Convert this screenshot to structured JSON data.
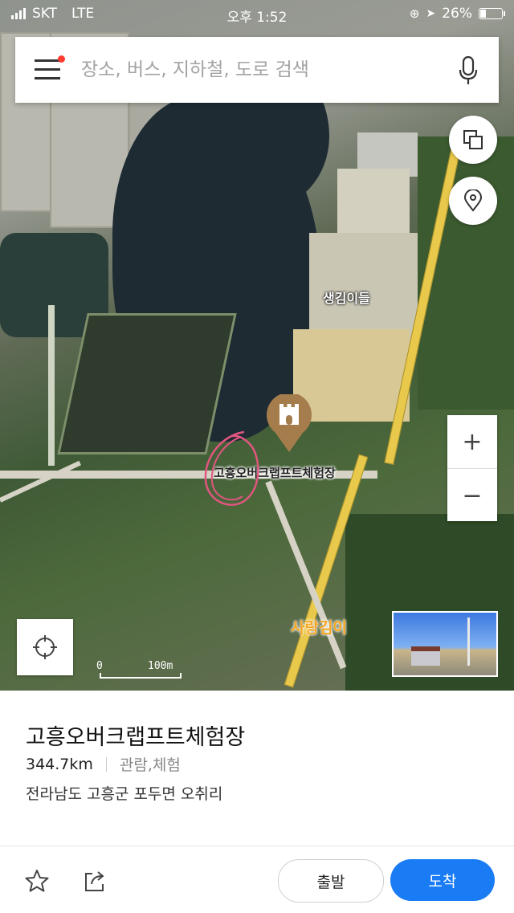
{
  "status_bar": {
    "carrier": "SKT",
    "network": "LTE",
    "time": "오후 1:52",
    "battery": "26%"
  },
  "search": {
    "placeholder": "장소, 버스, 지하철, 도로 검색"
  },
  "map": {
    "labels": {
      "area_name": "생김이들",
      "poi_name": "고흥오버크랩프트체험장",
      "nearby_poi": "사랑김이"
    },
    "scale": {
      "zero": "0",
      "distance": "100m"
    }
  },
  "place": {
    "name": "고흥오버크랩프트체험장",
    "distance": "344.7km",
    "category": "관람,체험",
    "address": "전라남도 고흥군 포두면 오취리"
  },
  "actions": {
    "depart_label": "출발",
    "arrive_label": "도착"
  },
  "zoom": {
    "in": "+",
    "out": "−"
  },
  "colors": {
    "accent": "#1a7cf5",
    "pin": "#a57c4c",
    "notification_dot": "#ff3b30"
  }
}
